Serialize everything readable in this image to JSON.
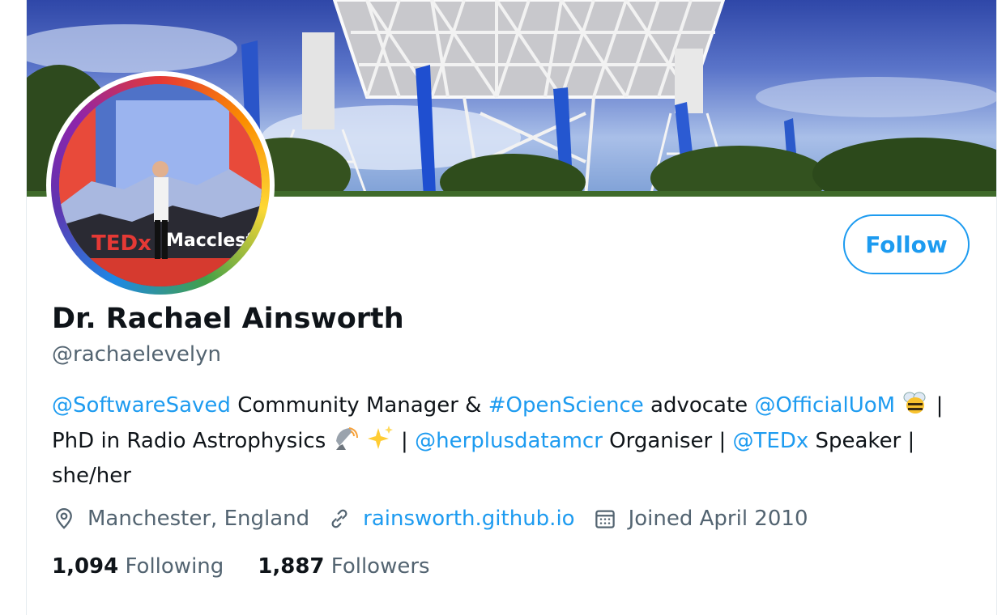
{
  "profile": {
    "name": "Dr. Rachael Ainsworth",
    "handle": "@rachaelevelyn",
    "follow_label": "Follow"
  },
  "bio": {
    "mention_softwaresaved": "@SoftwareSaved",
    "text_1": " Community Manager & ",
    "hashtag_openscience": "#OpenScience",
    "text_2": " advocate ",
    "mention_officialuom": "@OfficialUoM",
    "text_3": " | PhD in Radio Astrophysics ",
    "text_4": " | ",
    "mention_herplusdatamcr": "@herplusdatamcr",
    "text_5": " Organiser | ",
    "mention_tedx": "@TEDx",
    "text_6": " Speaker | she/her"
  },
  "avatar_text": "Macclesfi",
  "avatar_brand": "TEDx",
  "meta": {
    "location": "Manchester, England",
    "website": "rainsworth.github.io",
    "joined": "Joined April 2010"
  },
  "stats": {
    "following_count": "1,094",
    "following_label": "Following",
    "followers_count": "1,887",
    "followers_label": "Followers"
  },
  "icons": {
    "location": "map-pin-icon",
    "website": "link-icon",
    "joined": "calendar-icon",
    "bee": "bee-emoji",
    "satellite": "satellite-dish-emoji",
    "sparkles": "sparkles-emoji"
  },
  "colors": {
    "accent": "#1d9bf0",
    "text": "#0f1419",
    "secondary": "#536471"
  }
}
